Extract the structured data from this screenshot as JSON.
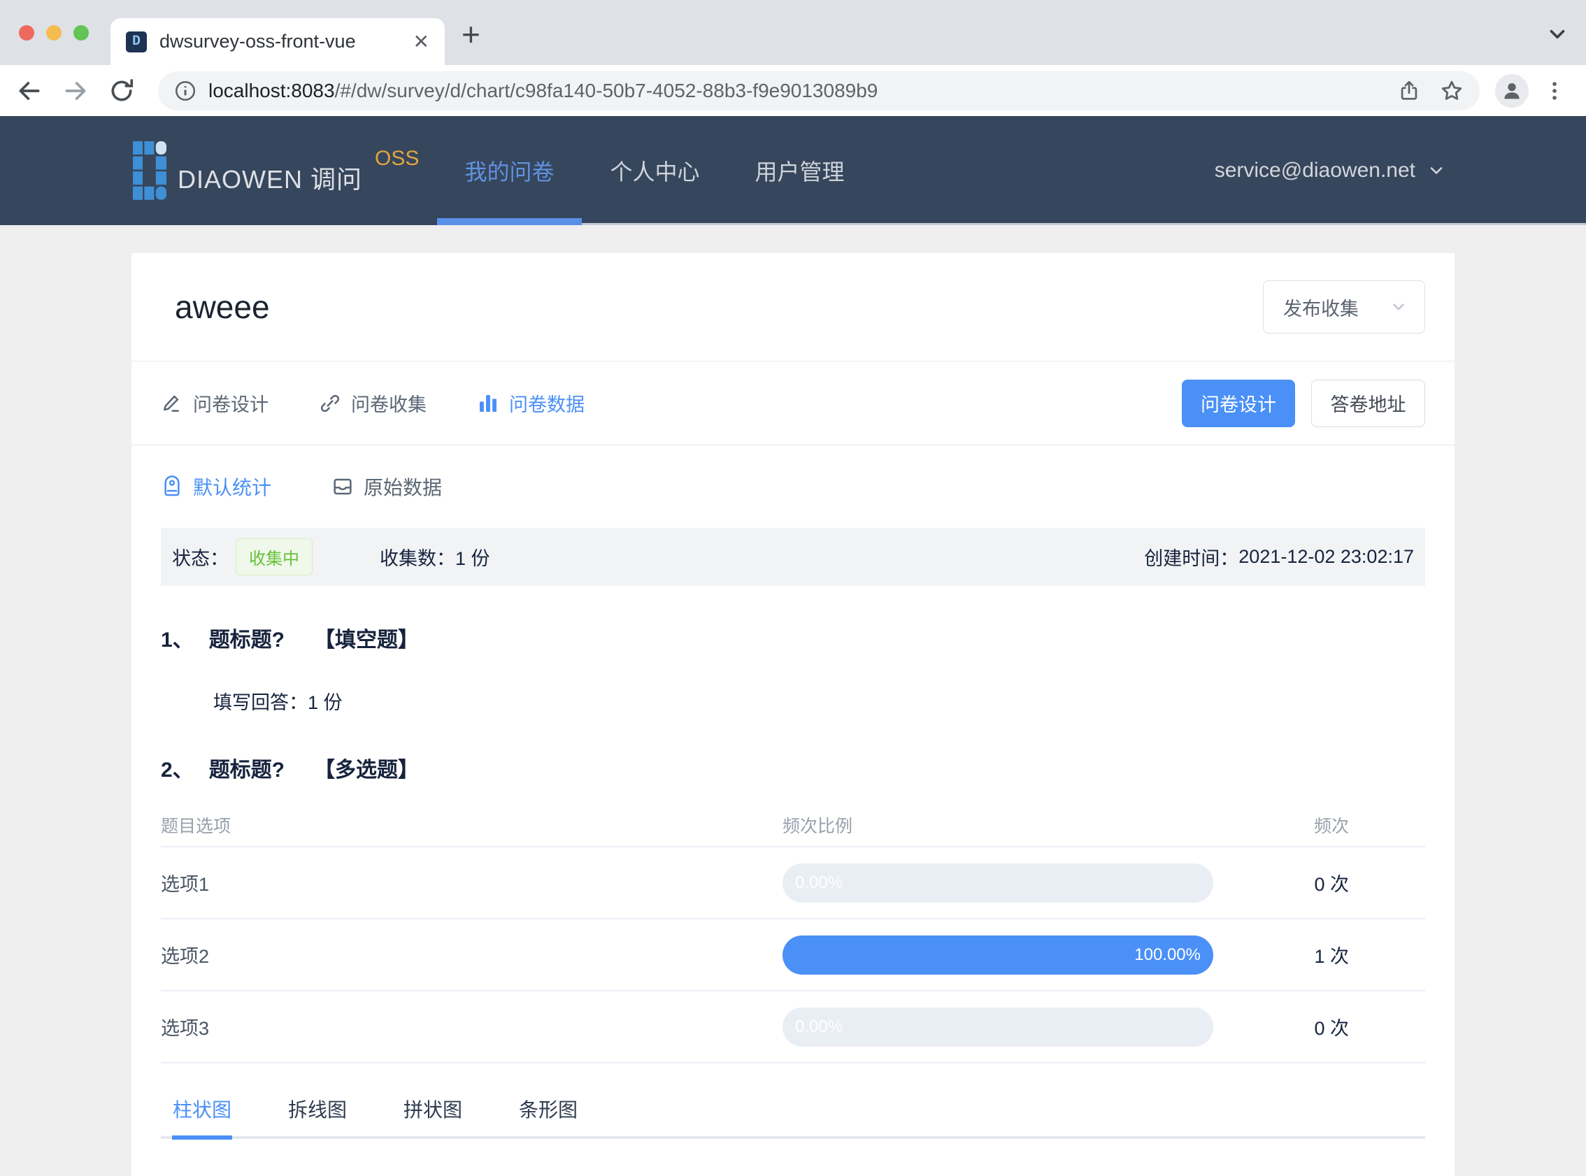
{
  "colors": {
    "accent": "#4a90f7",
    "header_bg": "#36465c",
    "success_green": "#67c23a",
    "brand_orange": "#e2a43f"
  },
  "browser": {
    "tab_title": "dwsurvey-oss-front-vue",
    "favicon_letter": "D",
    "url_host": "localhost:8083",
    "url_path": "/#/dw/survey/d/chart/c98fa140-50b7-4052-88b3-f9e9013089b9"
  },
  "header": {
    "brand": "DIAOWEN 调问",
    "brand_badge": "OSS",
    "nav": [
      {
        "label": "我的问卷"
      },
      {
        "label": "个人中心"
      },
      {
        "label": "用户管理"
      }
    ],
    "account": "service@diaowen.net"
  },
  "survey": {
    "title": "aweee",
    "publish_select": "发布收集",
    "tabs": [
      {
        "label": "问卷设计"
      },
      {
        "label": "问卷收集"
      },
      {
        "label": "问卷数据"
      }
    ],
    "primary_button": "问卷设计",
    "secondary_button": "答卷地址",
    "subtabs": [
      {
        "label": "默认统计"
      },
      {
        "label": "原始数据"
      }
    ],
    "status": {
      "status_label": "状态：",
      "status_badge": "收集中",
      "count_label": "收集数：",
      "count_value": "1 份",
      "created_label": "创建时间：",
      "created_value": "2021-12-02 23:02:17"
    }
  },
  "question1": {
    "no": "1、",
    "title": "题标题?",
    "type": "【填空题】",
    "answer_label": "填写回答：",
    "answer_value": "1 份"
  },
  "question2": {
    "no": "2、",
    "title": "题标题?",
    "type": "【多选题】"
  },
  "table": {
    "headers": [
      "题目选项",
      "频次比例",
      "频次"
    ],
    "rows": [
      {
        "option": "选项1",
        "percent": 0,
        "percent_label": "0.00%",
        "count": "0 次"
      },
      {
        "option": "选项2",
        "percent": 100,
        "percent_label": "100.00%",
        "count": "1 次"
      },
      {
        "option": "选项3",
        "percent": 0,
        "percent_label": "0.00%",
        "count": "0 次"
      }
    ]
  },
  "chart_tabs": [
    {
      "label": "柱状图"
    },
    {
      "label": "拆线图"
    },
    {
      "label": "拼状图"
    },
    {
      "label": "条形图"
    }
  ]
}
